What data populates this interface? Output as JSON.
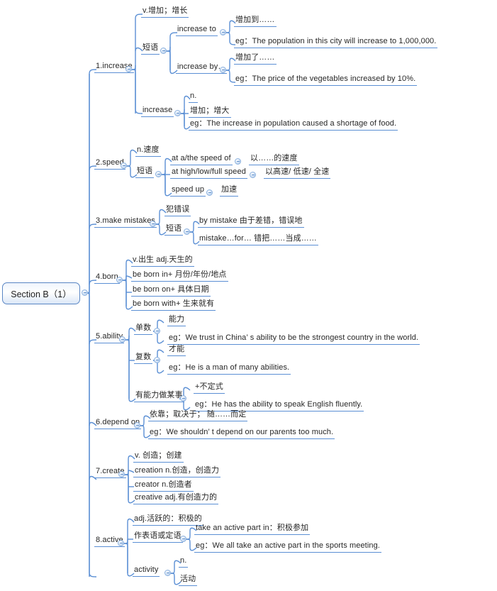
{
  "title": "Section B（1）",
  "colors": {
    "line": "#5b8fd4",
    "text": "#262626",
    "root_border": "#5a86c4"
  },
  "root": {
    "label": "Section B（1）"
  },
  "branches": [
    {
      "label": "1.increase",
      "children": [
        {
          "label": "v.增加；增长"
        },
        {
          "label": "短语",
          "children": [
            {
              "label": "increase to",
              "children": [
                {
                  "label": "增加到……"
                },
                {
                  "label": "eg：The population in this city will increase to 1,000,000."
                }
              ]
            },
            {
              "label": "increase by…",
              "children": [
                {
                  "label": "增加了……"
                },
                {
                  "label": "eg：The price of the vegetables increased by 10%."
                }
              ]
            }
          ]
        },
        {
          "label": "increase",
          "children": [
            {
              "label": "n."
            },
            {
              "label": "增加；增大"
            },
            {
              "label": "eg：The increase in population caused a  shortage of food."
            }
          ]
        }
      ]
    },
    {
      "label": "2.speed",
      "children": [
        {
          "label": "n.速度"
        },
        {
          "label": "短语",
          "children": [
            {
              "label": "at a/the speed of",
              "children": [
                {
                  "label": "以……的速度"
                }
              ]
            },
            {
              "label": "at high/low/full speed",
              "children": [
                {
                  "label": "以高速/ 低速/ 全速"
                }
              ]
            },
            {
              "label": "speed up",
              "children": [
                {
                  "label": "加速"
                }
              ]
            }
          ]
        }
      ]
    },
    {
      "label": "3.make  mistakes",
      "children": [
        {
          "label": "犯错误"
        },
        {
          "label": "短语",
          "children": [
            {
              "label": "by mistake 由于差错，错误地"
            },
            {
              "label": "mistake…for… 错把……当成……"
            }
          ]
        }
      ]
    },
    {
      "label": "4.born",
      "children": [
        {
          "label": "v.出生 adj.天生的"
        },
        {
          "label": "be born in+ 月份/年份/地点"
        },
        {
          "label": "be born on+ 具体日期"
        },
        {
          "label": "be born with+ 生来就有"
        }
      ]
    },
    {
      "label": "5.ability",
      "children": [
        {
          "label": "单数",
          "children": [
            {
              "label": "能力"
            },
            {
              "label": "eg：We trust in China’ s ability to be the strongest country in the world."
            }
          ]
        },
        {
          "label": "复数",
          "children": [
            {
              "label": "才能"
            },
            {
              "label": "eg：He is a man of many abilities."
            }
          ]
        },
        {
          "label": "有能力做某事",
          "children": [
            {
              "label": "+不定式"
            },
            {
              "label": "eg：He has the ability to speak English fluently."
            }
          ]
        }
      ]
    },
    {
      "label": "6.depend on",
      "children": [
        {
          "label": "依靠；取决于； 随……而定"
        },
        {
          "label": "eg：We shouldn’ t depend on our parents too much."
        }
      ]
    },
    {
      "label": "7.create",
      "children": [
        {
          "label": "v. 创造；创建"
        },
        {
          "label": "creation n.创造，创造力"
        },
        {
          "label": "creator n.创造者"
        },
        {
          "label": "creative adj.有创造力的"
        }
      ]
    },
    {
      "label": "8.active",
      "children": [
        {
          "label": "adj.活跃的：积极的"
        },
        {
          "label": "作表语或定语",
          "children": [
            {
              "label": "take an active part in：积极参加"
            },
            {
              "label": "eg：We all take an active part in the sports meeting."
            }
          ]
        },
        {
          "label": "activity",
          "children": [
            {
              "label": "n."
            },
            {
              "label": "活动"
            }
          ]
        }
      ]
    }
  ],
  "nodes": {
    "n_incr": "1.increase",
    "n_incr_v": "v.增加；增长",
    "n_incr_ph": "短语",
    "n_incr_to": "increase to",
    "n_incr_to_cn": "增加到……",
    "n_incr_to_eg": "eg：The population in this city will increase to 1,000,000.",
    "n_incr_by": "increase by…",
    "n_incr_by_cn": "增加了……",
    "n_incr_by_eg": "eg：The price of the vegetables increased by 10%.",
    "n_incr_n": "increase",
    "n_incr_n_pos": "n.",
    "n_incr_n_cn": "增加；增大",
    "n_incr_n_eg": "eg：The increase in population caused a  shortage of food.",
    "n_speed": "2.speed",
    "n_speed_n": "n.速度",
    "n_speed_ph": "短语",
    "n_speed_a": "at a/the speed of",
    "n_speed_a_cn": "以……的速度",
    "n_speed_b": "at high/low/full speed",
    "n_speed_b_cn": "以高速/ 低速/ 全速",
    "n_speed_c": "speed up",
    "n_speed_c_cn": "加速",
    "n_mis": "3.make  mistakes",
    "n_mis_cn": "犯错误",
    "n_mis_ph": "短语",
    "n_mis_by": "by mistake 由于差错，错误地",
    "n_mis_for": "mistake…for… 错把……当成……",
    "n_born": "4.born",
    "n_born_pos": "v.出生 adj.天生的",
    "n_born_in": "be born in+ 月份/年份/地点",
    "n_born_on": "be born on+ 具体日期",
    "n_born_with": "be born with+ 生来就有",
    "n_abi": "5.ability",
    "n_abi_s": "单数",
    "n_abi_s_cn": "能力",
    "n_abi_s_eg": "eg：We trust in China’ s ability to be the strongest country in the world.",
    "n_abi_p": "复数",
    "n_abi_p_cn": "才能",
    "n_abi_p_eg": "eg：He is a man of many abilities.",
    "n_abi_d": "有能力做某事",
    "n_abi_d_cn": "+不定式",
    "n_abi_d_eg": "eg：He has the ability to speak English fluently.",
    "n_dep": "6.depend on",
    "n_dep_cn": "依靠；取决于； 随……而定",
    "n_dep_eg": "eg：We shouldn’ t depend on our parents too much.",
    "n_cre": "7.create",
    "n_cre_v": "v. 创造；创建",
    "n_cre_n": "creation n.创造，创造力",
    "n_cre_r": "creator n.创造者",
    "n_cre_a": "creative adj.有创造力的",
    "n_act": "8.active",
    "n_act_adj": "adj.活跃的：积极的",
    "n_act_pred": "作表语或定语",
    "n_act_take": "take an active part in：积极参加",
    "n_act_eg": "eg：We all take an active part in the sports meeting.",
    "n_actv": "activity",
    "n_actv_n": "n.",
    "n_actv_cn": "活动"
  }
}
